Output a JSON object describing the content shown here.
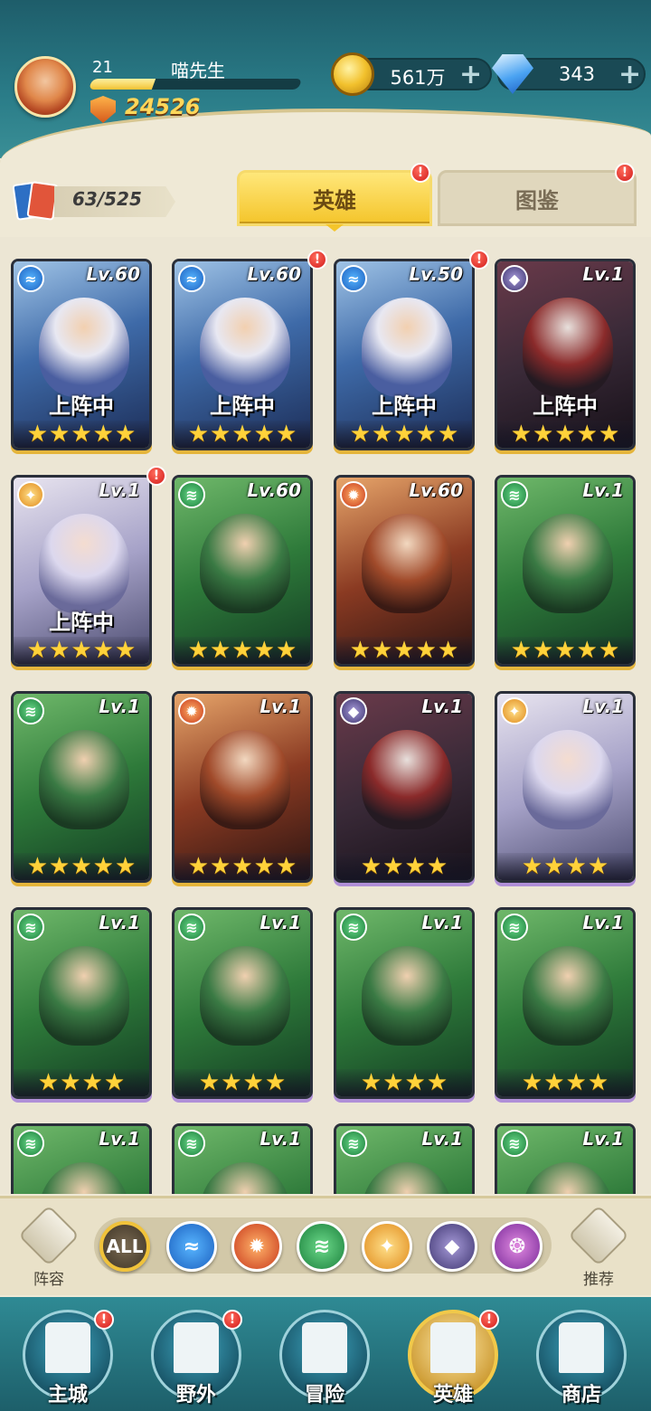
{
  "player": {
    "level": "21",
    "name": "喵先生",
    "xp_fraction": 0.3,
    "power": "24526"
  },
  "resources": {
    "gold": "561万",
    "gems": "343"
  },
  "collection": {
    "count": "63/525"
  },
  "tabs": {
    "heroes": "英雄",
    "codex": "图鉴"
  },
  "cards": [
    {
      "level": "Lv.60",
      "element": "water",
      "deployed": "上阵中",
      "stars": 5,
      "badge": false,
      "tone": "gold"
    },
    {
      "level": "Lv.60",
      "element": "water",
      "deployed": "上阵中",
      "stars": 5,
      "badge": true,
      "tone": "gold"
    },
    {
      "level": "Lv.50",
      "element": "water",
      "deployed": "上阵中",
      "stars": 5,
      "badge": true,
      "tone": "gold"
    },
    {
      "level": "Lv.1",
      "element": "dark",
      "deployed": "上阵中",
      "stars": 5,
      "badge": false,
      "tone": "gold"
    },
    {
      "level": "Lv.1",
      "element": "light",
      "deployed": "上阵中",
      "stars": 5,
      "badge": true,
      "tone": "gold"
    },
    {
      "level": "Lv.60",
      "element": "wind",
      "deployed": "",
      "stars": 5,
      "badge": false,
      "tone": "gold"
    },
    {
      "level": "Lv.60",
      "element": "fire",
      "deployed": "",
      "stars": 5,
      "badge": false,
      "tone": "gold"
    },
    {
      "level": "Lv.1",
      "element": "wind",
      "deployed": "",
      "stars": 5,
      "badge": false,
      "tone": "gold"
    },
    {
      "level": "Lv.1",
      "element": "wind",
      "deployed": "",
      "stars": 5,
      "badge": false,
      "tone": "gold"
    },
    {
      "level": "Lv.1",
      "element": "fire",
      "deployed": "",
      "stars": 5,
      "badge": false,
      "tone": "gold"
    },
    {
      "level": "Lv.1",
      "element": "dark",
      "deployed": "",
      "stars": 4,
      "badge": false,
      "tone": "purple"
    },
    {
      "level": "Lv.1",
      "element": "light",
      "deployed": "",
      "stars": 4,
      "badge": false,
      "tone": "purple"
    },
    {
      "level": "Lv.1",
      "element": "wind",
      "deployed": "",
      "stars": 4,
      "badge": false,
      "tone": "purple"
    },
    {
      "level": "Lv.1",
      "element": "wind",
      "deployed": "",
      "stars": 4,
      "badge": false,
      "tone": "purple"
    },
    {
      "level": "Lv.1",
      "element": "wind",
      "deployed": "",
      "stars": 4,
      "badge": false,
      "tone": "purple"
    },
    {
      "level": "Lv.1",
      "element": "wind",
      "deployed": "",
      "stars": 4,
      "badge": false,
      "tone": "purple"
    },
    {
      "level": "Lv.1",
      "element": "wind",
      "deployed": "",
      "stars": 0,
      "badge": false,
      "tone": "purple"
    },
    {
      "level": "Lv.1",
      "element": "wind",
      "deployed": "",
      "stars": 0,
      "badge": false,
      "tone": "purple"
    },
    {
      "level": "Lv.1",
      "element": "wind",
      "deployed": "",
      "stars": 0,
      "badge": false,
      "tone": "purple"
    },
    {
      "level": "Lv.1",
      "element": "wind",
      "deployed": "",
      "stars": 0,
      "badge": false,
      "tone": "purple"
    }
  ],
  "filters": {
    "lineup_label": "阵容",
    "recommend_label": "推荐",
    "all_label": "ALL",
    "elements": [
      "water",
      "fire",
      "wind",
      "light",
      "dark",
      "arcane"
    ]
  },
  "nav": [
    {
      "label": "主城",
      "badge": true,
      "icon": "castle-icon"
    },
    {
      "label": "野外",
      "badge": true,
      "icon": "portal-icon"
    },
    {
      "label": "冒险",
      "badge": false,
      "icon": "sword-icon"
    },
    {
      "label": "英雄",
      "badge": true,
      "icon": "helmet-icon",
      "active": true
    },
    {
      "label": "商店",
      "badge": false,
      "icon": "shop-icon"
    }
  ],
  "colors": {
    "header_teal": "#2a7c88",
    "tab_gold": "#f4c52b",
    "badge_red": "#d21d1d",
    "star_gold": "#ffd23a"
  }
}
